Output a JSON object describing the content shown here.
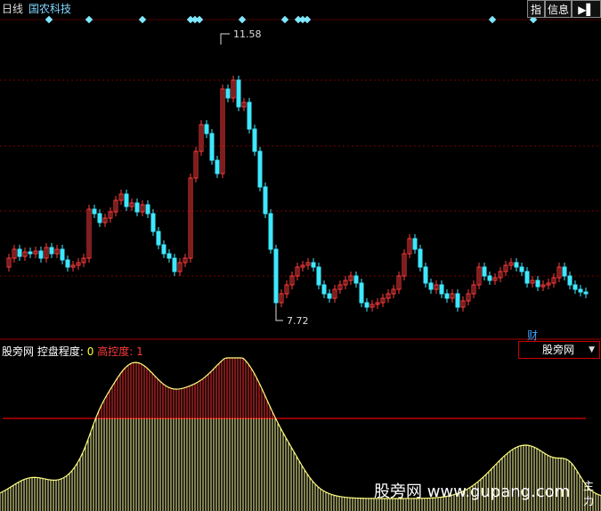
{
  "topbar": {
    "period": "日线",
    "stock_name": "国农科技",
    "btn_index": "指",
    "btn_info": "信息",
    "btn_arrow": "▶▌"
  },
  "main_chart": {
    "high_label": "11.58",
    "low_label": "7.72",
    "cai_badge": "财",
    "colors": {
      "up": "#ff3b3b",
      "down": "#3ee8ff",
      "grid": "#7a0000",
      "marker": "#7fe8ff"
    }
  },
  "indicator": {
    "name": "股旁网",
    "label_ctrl": "控盘程度:",
    "ctrl_value": "0",
    "label_high": "高控度:",
    "high_value": "1",
    "dropdown_value": "股旁网"
  },
  "watermark": {
    "text": "股旁网 www.gupang.com",
    "edge_text": "主力"
  }
}
